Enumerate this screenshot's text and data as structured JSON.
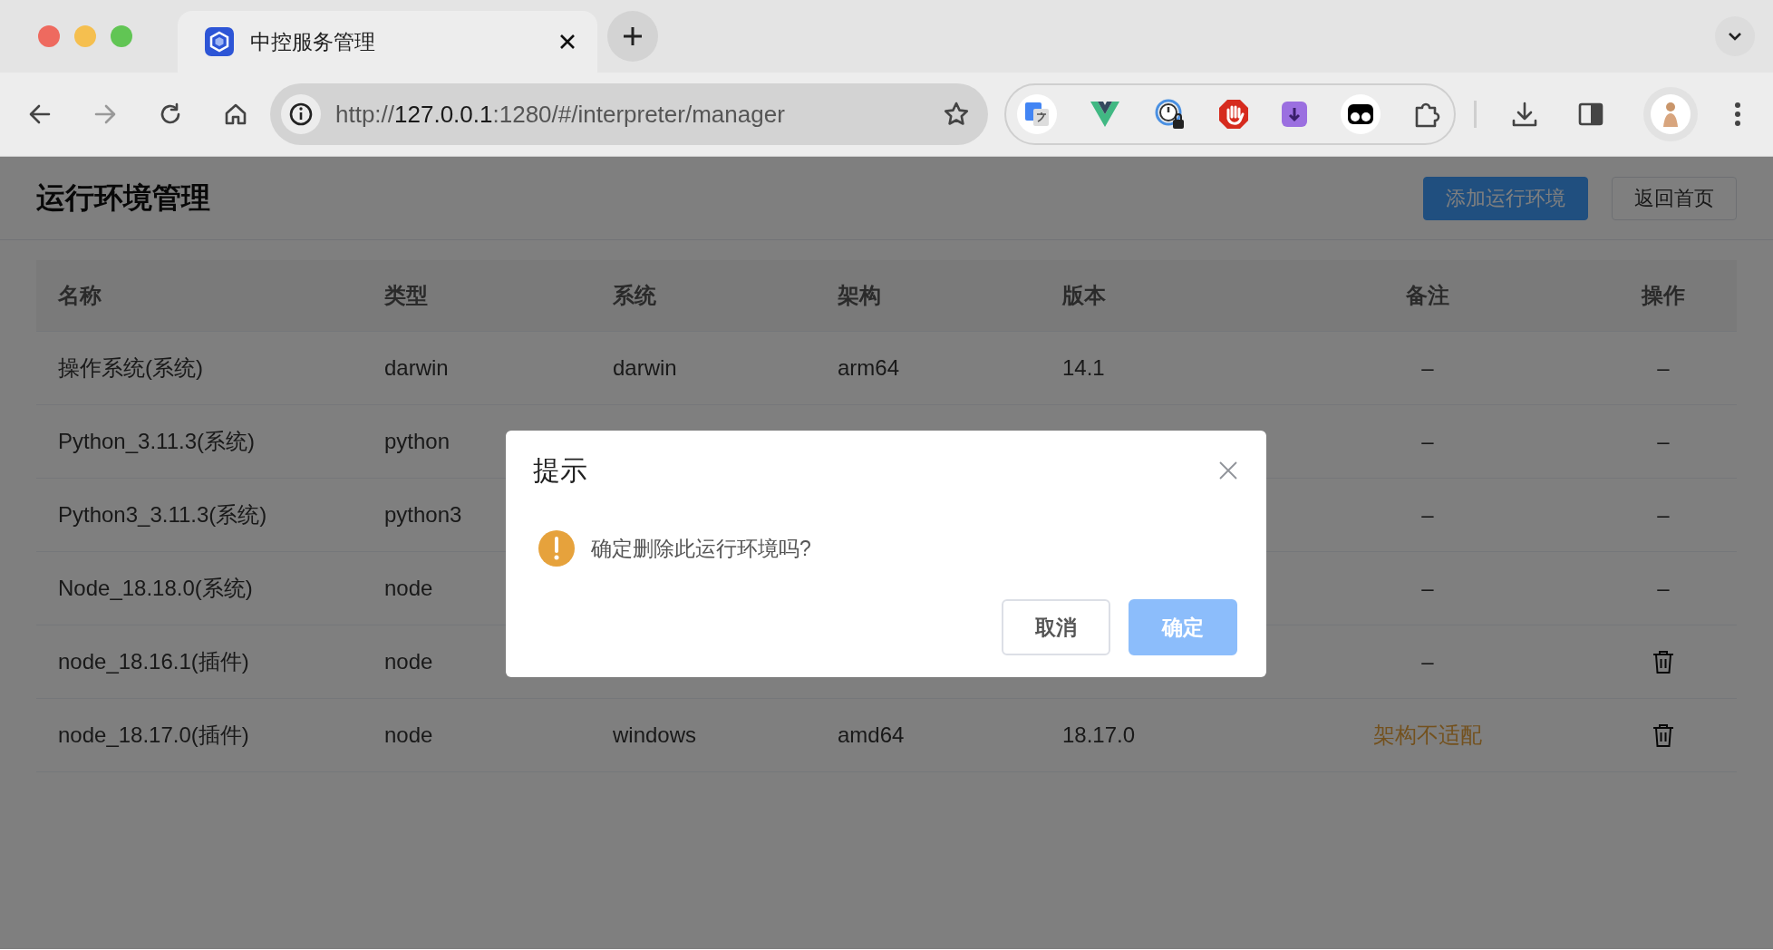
{
  "browser": {
    "tab": {
      "title": "中控服务管理",
      "selected": true
    },
    "url": {
      "scheme": "http://",
      "host": "127.0.0.1",
      "path": ":1280/#/interpreter/manager"
    }
  },
  "page": {
    "title": "运行环境管理",
    "buttons": [
      {
        "label": "添加运行环境",
        "kind": "primary"
      },
      {
        "label": "返回首页",
        "kind": "plain"
      }
    ]
  },
  "table": {
    "columns": [
      "名称",
      "类型",
      "系统",
      "架构",
      "版本",
      "备注",
      "操作"
    ],
    "rows": [
      {
        "name": "操作系统(系统)",
        "type": "darwin",
        "system": "darwin",
        "arch": "arm64",
        "version": "14.1",
        "note": "–",
        "note_warning": false,
        "deletable": false,
        "action": "–"
      },
      {
        "name": "Python_3.11.3(系统)",
        "type": "python",
        "note": "–",
        "note_warning": false,
        "deletable": false,
        "action": "–"
      },
      {
        "name": "Python3_3.11.3(系统)",
        "type": "python3",
        "note": "–",
        "note_warning": false,
        "deletable": false,
        "action": "–"
      },
      {
        "name": "Node_18.18.0(系统)",
        "type": "node",
        "note": "–",
        "note_warning": false,
        "deletable": false,
        "action": "–"
      },
      {
        "name": "node_18.16.1(插件)",
        "type": "node",
        "note": "–",
        "note_warning": false,
        "deletable": true
      },
      {
        "name": "node_18.17.0(插件)",
        "type": "node",
        "system": "windows",
        "arch": "amd64",
        "version": "18.17.0",
        "note": "架构不适配",
        "note_warning": true,
        "deletable": true
      }
    ]
  },
  "dialog": {
    "title": "提示",
    "message": "确定删除此运行环境吗?",
    "buttons": [
      {
        "label": "取消",
        "kind": "plain"
      },
      {
        "label": "确定",
        "kind": "primary"
      }
    ]
  }
}
